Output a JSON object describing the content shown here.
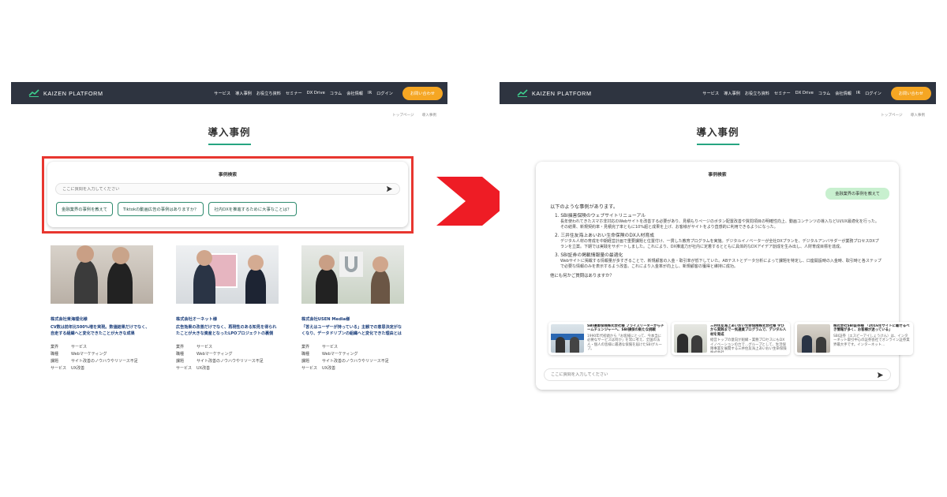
{
  "nav": {
    "logo": "KAIZEN PLATFORM",
    "links": [
      "サービス",
      "導入事例",
      "お役立ち資料",
      "セミナー",
      "DX Drive",
      "コラム",
      "会社情報",
      "IR",
      "ログイン"
    ],
    "cta": "お問い合わせ"
  },
  "breadcrumb": [
    "トップページ",
    "導入事例"
  ],
  "page_title": "導入事例",
  "search": {
    "title": "事例検索",
    "placeholder": "ここに質問を入力してください",
    "chips": [
      "金融業界の事例を教えて",
      "Tiktokの動画広告の事例はありますか？",
      "社内DXを推進するために大事なことは？"
    ]
  },
  "meta_labels": [
    "業界",
    "職種",
    "課題",
    "サービス"
  ],
  "cases": [
    {
      "company": "株式会社東海理化様",
      "headline": "CV数は前年比500%増を実現。数値結果だけでなく、自走する組織へと変化できたことが大きな成果",
      "values": [
        "サービス",
        "Webマーケティング",
        "サイト改善のノウハウやリソース不足",
        "UX改善"
      ]
    },
    {
      "company": "株式会社オーネット様",
      "headline": "広告効果の改善だけでなく、再現性のある知見を得られたことが大きな資産となったLPOプロジェクトの裏側",
      "values": [
        "サービス",
        "Webマーケティング",
        "サイト改善のノウハウやリソース不足",
        "UX改善"
      ]
    },
    {
      "company": "株式会社USEN Media様",
      "headline": "「答えはユーザーが持っている」主観での意思決定がなくなり、データドリブンの組織へと変化できた理由とは",
      "values": [
        "サービス",
        "Webマーケティング",
        "サイト改善のノウハウやリソース不足",
        "UX改善"
      ]
    }
  ],
  "chat": {
    "title": "事例検索",
    "user_message": "金融業界の事例を教えて",
    "intro": "以下のような事例があります。",
    "items": [
      {
        "title": "1. SBI損害保険のウェブサイトリニューアル",
        "desc": "長年使われてきたスマホ非対応のWebサイトを改善する必要があり、見積もりページのボタン配置改善や質問項目の明確性向上、動画コンテンツの導入などUI/UX最適化を行った。その結果、新規契約率・見積完了率ともに10%超と成果を上げ、お客様がサイトをより直感的に利用できるようになった。"
      },
      {
        "title": "2. 三井住友海上あいおい生命保険のDX人材育成",
        "desc": "デジタル人材の育成を中期経営計画で重要課題と位置付け、一貫した教育プログラムを実施。デジタルイノベーターが全社DXプランを、デジタルアンバサダーが業務プロセスDXプランを立案。下期では実践をサポートしました。これにより、DX推進力が社内に定着するとともに具体的なDXアイデア創成を生み出し、人財育成目標を達成。"
      },
      {
        "title": "3. SBI証券の掲載情報量の最適化",
        "desc": "Webサイトに掲載する情報量が多すぎることで、新規顧客の入金・取引率が低下していた。ABテストとデータ分析によって課題を特定し、口座開設時の入金時、取引時と各ステップで必要な情報のみを表示するよう改善。これにより入金率が向上し、新規顧客の獲得と維持に成功。"
      }
    ],
    "outro": "他にも何かご質問はありますか？",
    "refs": [
      {
        "title": "SBI損害保険株式会社様 プライスリーダーからチームチェンジャーへ、SBI損保の新たな挑戦",
        "desc": "1990年代初頭から「お客様にとって、今本当に必要なサービスは何か」を常に考え、全国の法人・個人の皆様に最適な保険を届けたSBIグループ。"
      },
      {
        "title": "三井住友海上あいおい生命保険株式会社様 学びから実践まで一気通貫プログラムで、デジタル人材を育成",
        "desc": "経営トップの意向が組織・業務プロセスにもDXイノベーションの力で…グループとして、生活保障事業を展開する三井住友海上あいおい生命保険株式会社"
      },
      {
        "title": "株式会社SBI証券様 「2016年サイトに載せるべき情報が多く、お客様が迷っている」",
        "desc": "SBI証券（エスビーアイしょうけん）は、インターネット取引中心の証券会社でオンライン証券業界最大手です。インターネット…"
      }
    ],
    "placeholder": "ここに質問を入力してください"
  },
  "colors": {
    "nav_bg": "#2e3440",
    "cta": "#f5a623",
    "accent_green": "#26a581",
    "highlight_red": "#e8362f",
    "user_bubble": "#c8f0cf"
  },
  "icons": [
    "kaizen-logo-icon",
    "send-icon",
    "arrow-right-icon"
  ]
}
